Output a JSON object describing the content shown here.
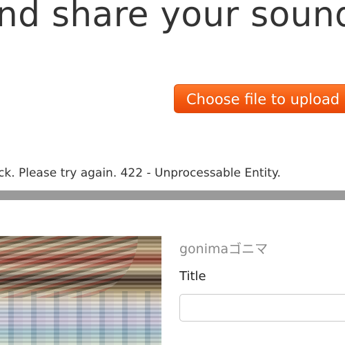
{
  "header": {
    "headline": "nd share your sound"
  },
  "upload": {
    "button_label": "Choose file to upload"
  },
  "error": {
    "message": "ck. Please try again. 422 - Unprocessable Entity."
  },
  "track": {
    "username": "gonimaゴニマ",
    "title_label": "Title",
    "title_value": "",
    "title_placeholder": ""
  },
  "colors": {
    "accent": "#f45a0e",
    "divider": "#9a9a9a",
    "text": "#333333"
  }
}
